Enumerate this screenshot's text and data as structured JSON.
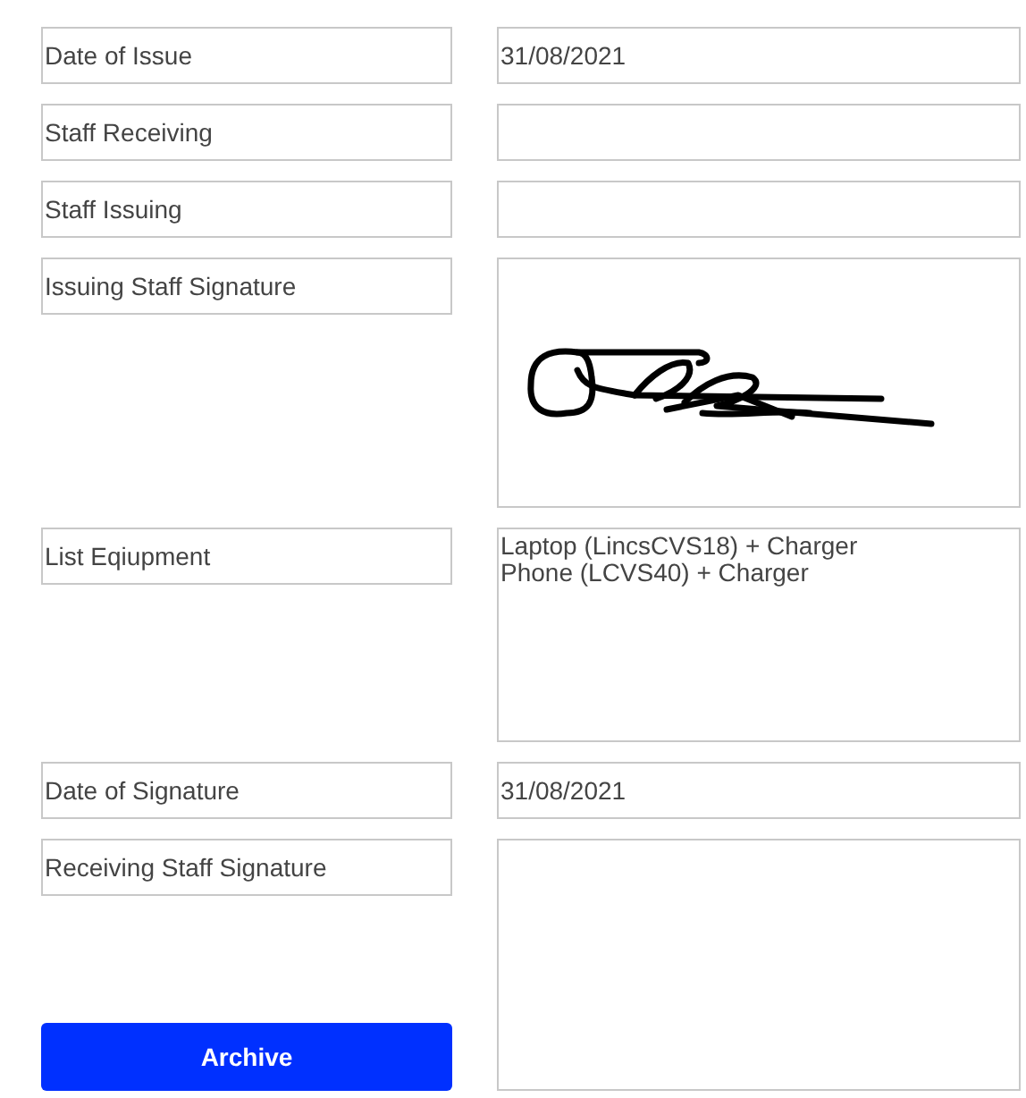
{
  "rows": [
    {
      "label": "Date of Issue",
      "kind": "text",
      "value": "31/08/2021"
    },
    {
      "label": "Staff Receiving",
      "kind": "text",
      "value": ""
    },
    {
      "label": "Staff Issuing",
      "kind": "text",
      "value": ""
    },
    {
      "label": "Issuing Staff Signature",
      "kind": "signature",
      "signed": true
    },
    {
      "label": "List Eqiupment",
      "kind": "multiline",
      "lines": [
        "Laptop (LincsCVS18) + Charger",
        "Phone (LCVS40) + Charger"
      ]
    },
    {
      "label": "Date of Signature",
      "kind": "text",
      "value": "31/08/2021"
    },
    {
      "label": "Receiving Staff Signature",
      "kind": "signature",
      "signed": false
    }
  ],
  "button": "Archive"
}
